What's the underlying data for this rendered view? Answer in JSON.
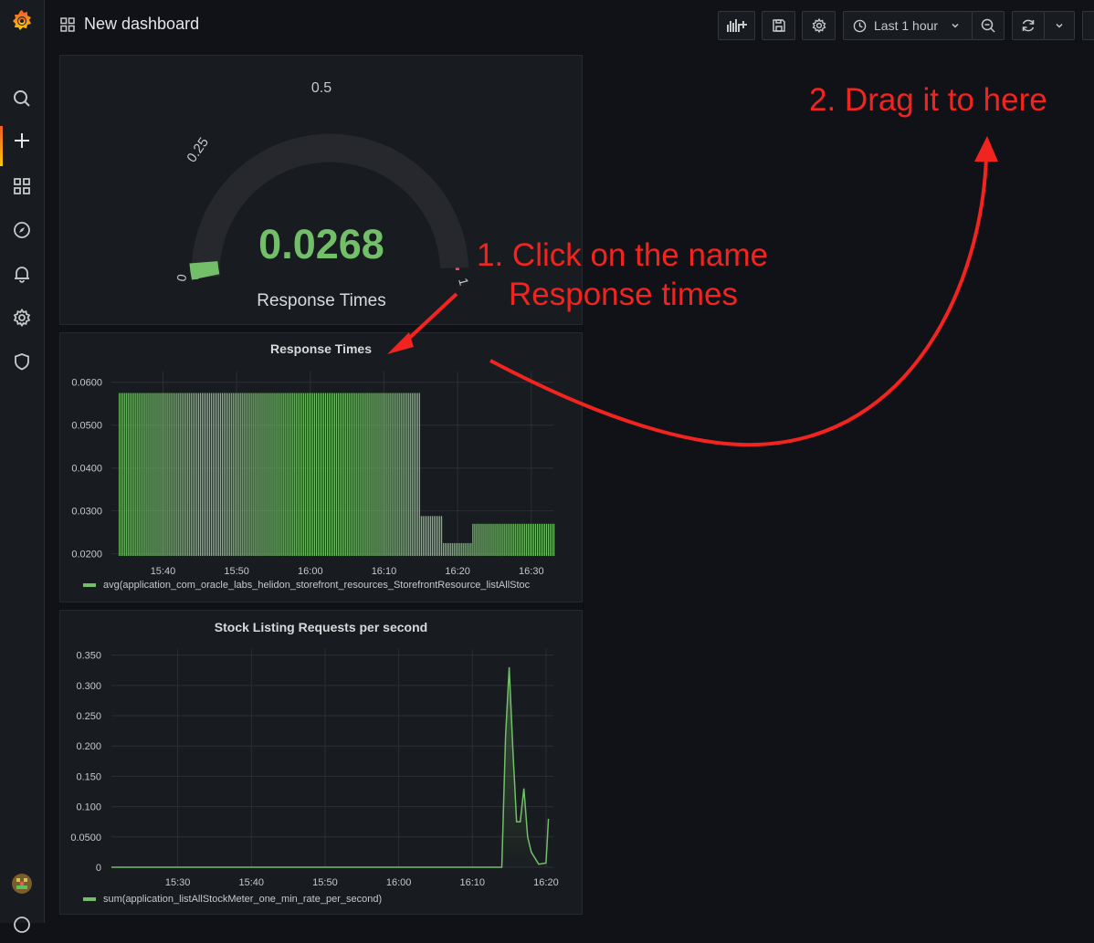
{
  "header": {
    "title": "New dashboard",
    "time_range": "Last 1 hour"
  },
  "sidebar": {
    "items": [
      {
        "name": "search-icon"
      },
      {
        "name": "plus-icon"
      },
      {
        "name": "dashboards-icon"
      },
      {
        "name": "compass-icon"
      },
      {
        "name": "bell-icon"
      },
      {
        "name": "gear-icon"
      },
      {
        "name": "shield-icon"
      }
    ]
  },
  "gauge": {
    "value": "0.0268",
    "label": "Response Times",
    "ticks": [
      "0",
      "0.25",
      "0.5",
      "1"
    ],
    "value_color": "#73bf69"
  },
  "panel_response": {
    "title": "Response Times",
    "legend": "avg(application_com_oracle_labs_helidon_storefront_resources_StorefrontResource_listAllStoc"
  },
  "panel_stock": {
    "title": "Stock Listing Requests per second",
    "legend": "sum(application_listAllStockMeter_one_min_rate_per_second)"
  },
  "annotations": {
    "step1_line1": "1. Click on the name",
    "step1_line2": "Response times",
    "step2": "2. Drag it to here"
  },
  "chart_data": [
    {
      "type": "bar",
      "title": "Response Times",
      "xlabel": "",
      "ylabel": "",
      "x_ticks": [
        "15:40",
        "15:50",
        "16:00",
        "16:10",
        "16:20",
        "16:30"
      ],
      "y_ticks": [
        "0.0200",
        "0.0300",
        "0.0400",
        "0.0500",
        "0.0600"
      ],
      "ylim": [
        0.0195,
        0.0625
      ],
      "xlim": [
        "15:33",
        "16:33"
      ],
      "series": [
        {
          "name": "avg(application_com_oracle_labs_helidon_storefront_resources_StorefrontResource_listAllStoc",
          "points": [
            {
              "x": "15:34",
              "y": 0.0575
            },
            {
              "x": "16:14",
              "y": 0.0575
            },
            {
              "x": "16:15",
              "y": 0.0288
            },
            {
              "x": "16:17",
              "y": 0.0288
            },
            {
              "x": "16:18",
              "y": 0.0225
            },
            {
              "x": "16:21",
              "y": 0.0225
            },
            {
              "x": "16:22",
              "y": 0.027
            },
            {
              "x": "16:33",
              "y": 0.027
            }
          ]
        }
      ]
    },
    {
      "type": "area",
      "title": "Stock Listing Requests per second",
      "xlabel": "",
      "ylabel": "",
      "x_ticks": [
        "15:30",
        "15:40",
        "15:50",
        "16:00",
        "16:10",
        "16:20"
      ],
      "y_ticks": [
        "0",
        "0.0500",
        "0.100",
        "0.150",
        "0.200",
        "0.250",
        "0.300",
        "0.350"
      ],
      "ylim": [
        0,
        0.36
      ],
      "xlim": [
        "15:21",
        "16:21"
      ],
      "series": [
        {
          "name": "sum(application_listAllStockMeter_one_min_rate_per_second)",
          "points": [
            {
              "x": "15:21",
              "y": 0
            },
            {
              "x": "16:14",
              "y": 0
            },
            {
              "x": "16:14:30",
              "y": 0.215
            },
            {
              "x": "16:15",
              "y": 0.33
            },
            {
              "x": "16:15:30",
              "y": 0.195
            },
            {
              "x": "16:16",
              "y": 0.075
            },
            {
              "x": "16:16:30",
              "y": 0.075
            },
            {
              "x": "16:17",
              "y": 0.13
            },
            {
              "x": "16:17:30",
              "y": 0.05
            },
            {
              "x": "16:18",
              "y": 0.025
            },
            {
              "x": "16:19",
              "y": 0.005
            },
            {
              "x": "16:20",
              "y": 0.007
            },
            {
              "x": "16:20:20",
              "y": 0.08
            }
          ]
        }
      ]
    }
  ]
}
